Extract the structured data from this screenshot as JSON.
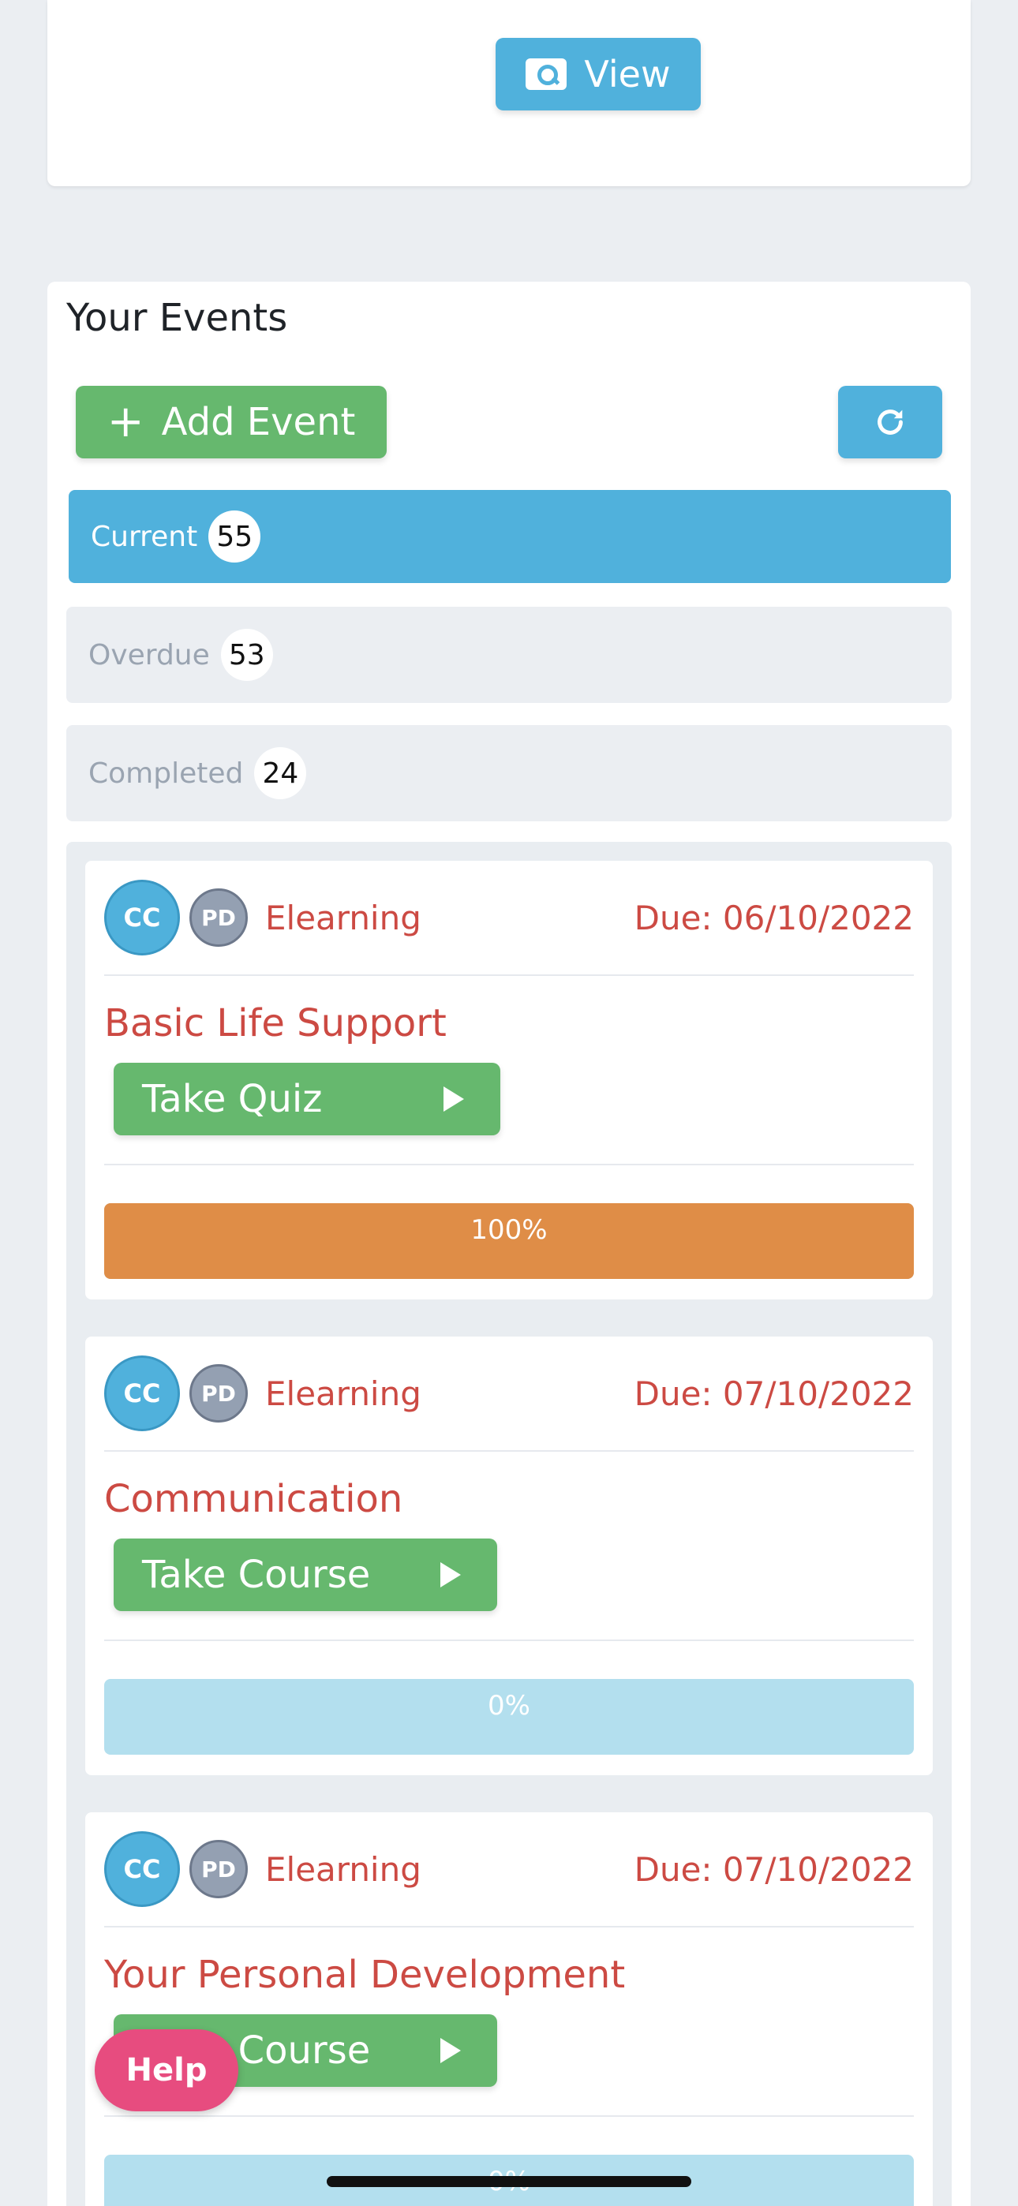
{
  "top_card": {
    "view_label": "View"
  },
  "events": {
    "title": "Your Events",
    "add_label": "Add Event",
    "tabs": [
      {
        "label": "Current",
        "count": "55"
      },
      {
        "label": "Overdue",
        "count": "53"
      },
      {
        "label": "Completed",
        "count": "24"
      }
    ],
    "items": [
      {
        "av1": "CC",
        "av2": "PD",
        "type": "Elearning",
        "due": "Due: 06/10/2022",
        "title": "Basic Life Support",
        "action": "Take Quiz",
        "progress_text": "100%",
        "progress": 1.0
      },
      {
        "av1": "CC",
        "av2": "PD",
        "type": "Elearning",
        "due": "Due: 07/10/2022",
        "title": "Communication",
        "action": "Take Course",
        "progress_text": "0%",
        "progress": 0.0
      },
      {
        "av1": "CC",
        "av2": "PD",
        "type": "Elearning",
        "due": "Due: 07/10/2022",
        "title": "Your Personal Development",
        "action": "Take Course",
        "progress_text": "0%",
        "progress": 0.0
      }
    ]
  },
  "help_label": "Help",
  "colors": {
    "primary": "#50b1dc",
    "success": "#66b86e",
    "danger": "#cc4a43",
    "progress": "#df8d47",
    "help": "#e74c7f"
  }
}
